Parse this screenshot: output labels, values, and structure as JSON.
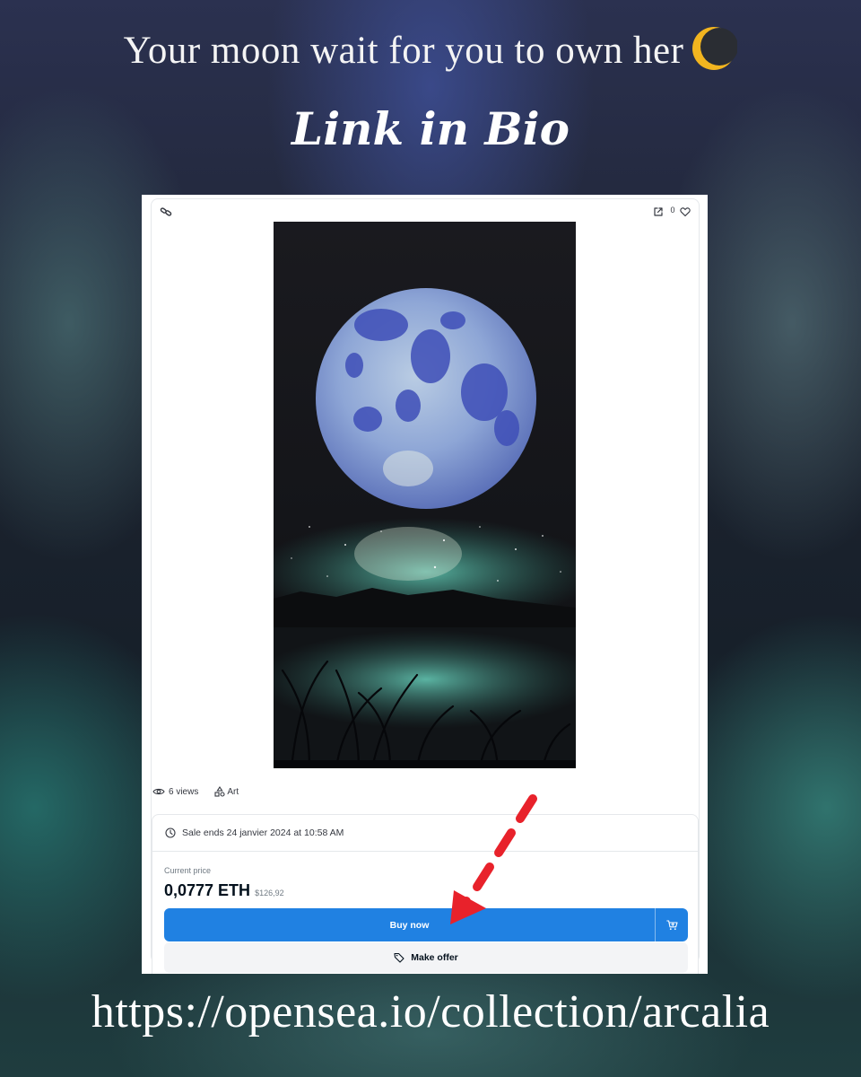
{
  "header": {
    "headline": "Your moon wait for you to own her",
    "headline_emoji": "crescent-moon-emoji",
    "subheadline": "Link in Bio"
  },
  "listing": {
    "toolbar": {
      "chain_icon": "link-icon",
      "open_icon": "external-link-icon",
      "like_count": "0",
      "like_icon": "heart-icon"
    },
    "artwork": {
      "description": "blue moon over aurora lake artwork",
      "colors": {
        "sky": "#17171b",
        "moon": "#6d84d6",
        "aurora": "#3a9a8c"
      }
    },
    "stats": {
      "views": "6 views",
      "category": "Art"
    },
    "sale": {
      "ends_text": "Sale ends 24 janvier 2024 at 10:58 AM",
      "price_label": "Current price",
      "price_eth": "0,0777 ETH",
      "price_usd": "$126,92",
      "buy_label": "Buy now",
      "offer_label": "Make offer"
    },
    "colors": {
      "accent": "#2081e2",
      "annotation_arrow": "#e8222b"
    }
  },
  "footer": {
    "url": "https://opensea.io/collection/arcalia"
  }
}
